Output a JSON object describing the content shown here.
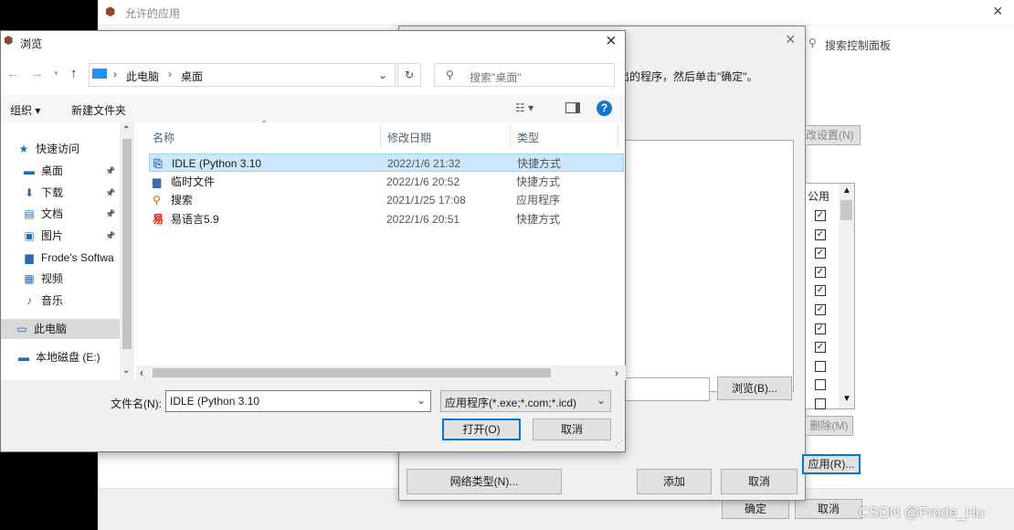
{
  "bg_window": {
    "title": "允许的应用",
    "search_placeholder": "搜索控制面板",
    "close": "×",
    "ok": "确定",
    "cancel": "取消"
  },
  "mid_dialog": {
    "instruction": "出的程序，然后单击\"确定\"。",
    "change_settings": "改设置(N)",
    "public_header": "公用",
    "checkboxes": [
      true,
      true,
      true,
      true,
      true,
      true,
      true,
      true,
      false,
      false,
      false
    ],
    "browse_btn": "浏览(B)...",
    "remove_btn": "删除(M)",
    "apply_btn": "应用(R)...",
    "network_btn": "网络类型(N)...",
    "add_btn": "添加",
    "cancel_btn": "取消",
    "close": "×"
  },
  "file_dialog": {
    "title": "浏览",
    "close": "×",
    "breadcrumb": [
      "此电脑",
      "桌面"
    ],
    "search_placeholder": "搜索\"桌面\"",
    "organize": "组织 ▾",
    "new_folder": "新建文件夹",
    "help": "?",
    "nav": [
      {
        "label": "快速访问",
        "icon": "★",
        "pin": false
      },
      {
        "label": "桌面",
        "icon": "▬",
        "pin": true
      },
      {
        "label": "下载",
        "icon": "⬇",
        "pin": true
      },
      {
        "label": "文档",
        "icon": "▤",
        "pin": true
      },
      {
        "label": "图片",
        "icon": "▣",
        "pin": true
      },
      {
        "label": "Frode's Softwa",
        "icon": "▆",
        "pin": false
      },
      {
        "label": "视频",
        "icon": "▦",
        "pin": false
      },
      {
        "label": "音乐",
        "icon": "♪",
        "pin": false
      },
      {
        "label": "此电脑",
        "icon": "▭",
        "pin": false
      },
      {
        "label": "本地磁盘 (E:)",
        "icon": "▬",
        "pin": false
      }
    ],
    "columns": {
      "name": "名称",
      "date": "修改日期",
      "type": "类型"
    },
    "files": [
      {
        "name": "IDLE (Python 3.10",
        "date": "2022/1/6 21:32",
        "type": "快捷方式",
        "icon": "⎘"
      },
      {
        "name": "临时文件",
        "date": "2022/1/6 20:52",
        "type": "快捷方式",
        "icon": "▆"
      },
      {
        "name": "搜索",
        "date": "2021/1/25 17:08",
        "type": "应用程序",
        "icon": "⚲"
      },
      {
        "name": "易语言5.9",
        "date": "2022/1/6 20:51",
        "type": "快捷方式",
        "icon": "易"
      }
    ],
    "filename_label": "文件名(N):",
    "filename_value": "IDLE (Python 3.10",
    "filetype": "应用程序(*.exe;*.com;*.icd)",
    "open": "打开(O)",
    "cancel": "取消"
  },
  "watermark": "CSDN @Frode_Hu"
}
